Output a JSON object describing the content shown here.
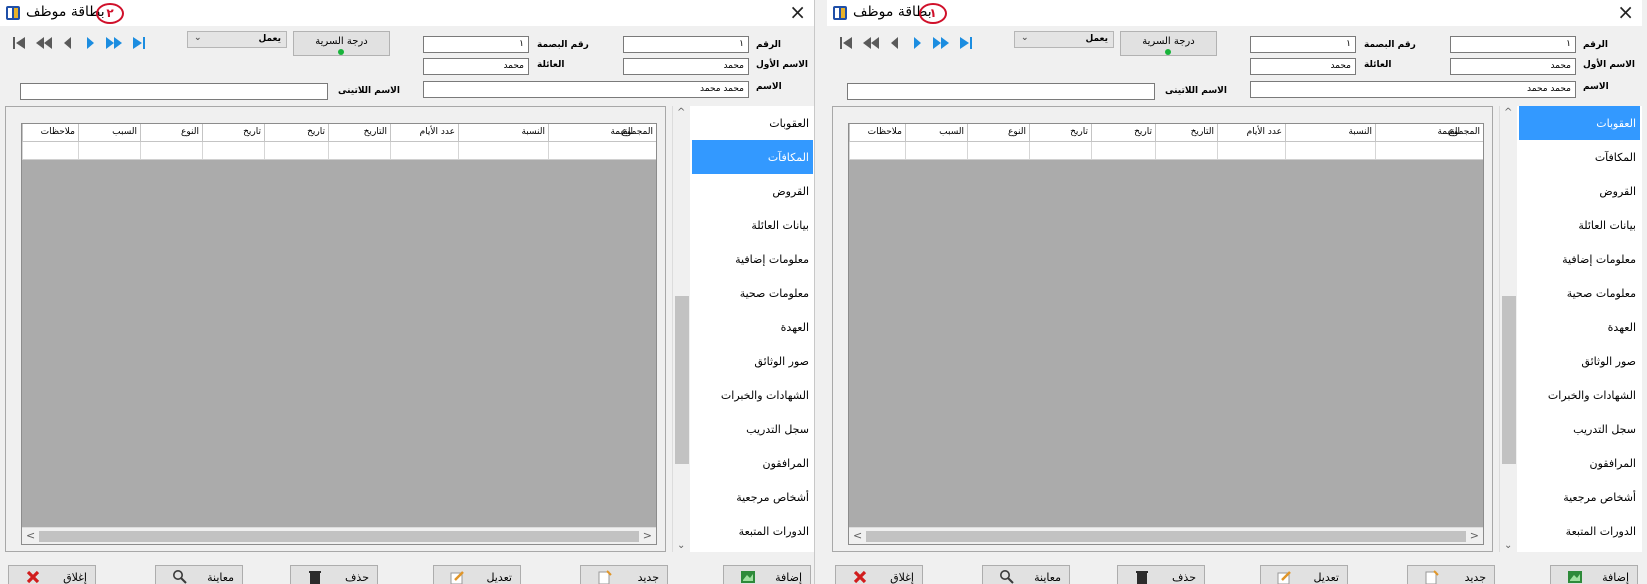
{
  "windows": [
    {
      "title": "بطاقة موظف",
      "marker": "٢",
      "selected_tab": 1
    },
    {
      "title": "بطاقة موظف",
      "marker": "١",
      "selected_tab": 0
    }
  ],
  "icons": {
    "close": "×",
    "nav_first": "first-record-icon",
    "nav_fast_back": "fast-back-icon",
    "nav_prev": "previous-icon",
    "nav_next": "next-icon",
    "nav_fast_forward": "fast-forward-icon",
    "nav_last": "last-record-icon"
  },
  "status": {
    "value": "يعمل",
    "arrow": "⌄"
  },
  "secret_button": "درجة السرية",
  "fields": {
    "number": {
      "label": "الرقم",
      "value": "١"
    },
    "fingerprint": {
      "label": "رقم البصمة",
      "value": "١"
    },
    "first_name": {
      "label": "الاسم الأول",
      "value": "محمد"
    },
    "family": {
      "label": "العائلة",
      "value": "محمد"
    },
    "name": {
      "label": "الاسم",
      "value": "محمد محمد"
    },
    "latin_name": {
      "label": "الاسم اللاتينى",
      "value": ""
    }
  },
  "grid": {
    "headers": [
      "المجموع",
      "القيمة",
      "النسبة",
      "عدد الأيام",
      "التاريخ",
      "تاريخ",
      "تاريخ",
      "النوع",
      "السبب",
      "ملاحظات"
    ]
  },
  "tabs": [
    "العقوبات",
    "المكافآت",
    "القروض",
    "بيانات العائلة",
    "معلومات إضافية",
    "معلومات صحية",
    "العهدة",
    "صور الوثائق",
    "الشهادات والخبرات",
    "سجل التدريب",
    "المرافقون",
    "أشخاص مرجعية",
    "الدورات المتبعة"
  ],
  "buttons": {
    "add": "إضافة",
    "new": "جديد",
    "edit": "تعديل",
    "delete": "حذف",
    "preview": "معاينة",
    "close": "إغلاق"
  },
  "scroll": {
    "left": "<",
    "right": ">",
    "up": "^",
    "down": "⌄"
  }
}
